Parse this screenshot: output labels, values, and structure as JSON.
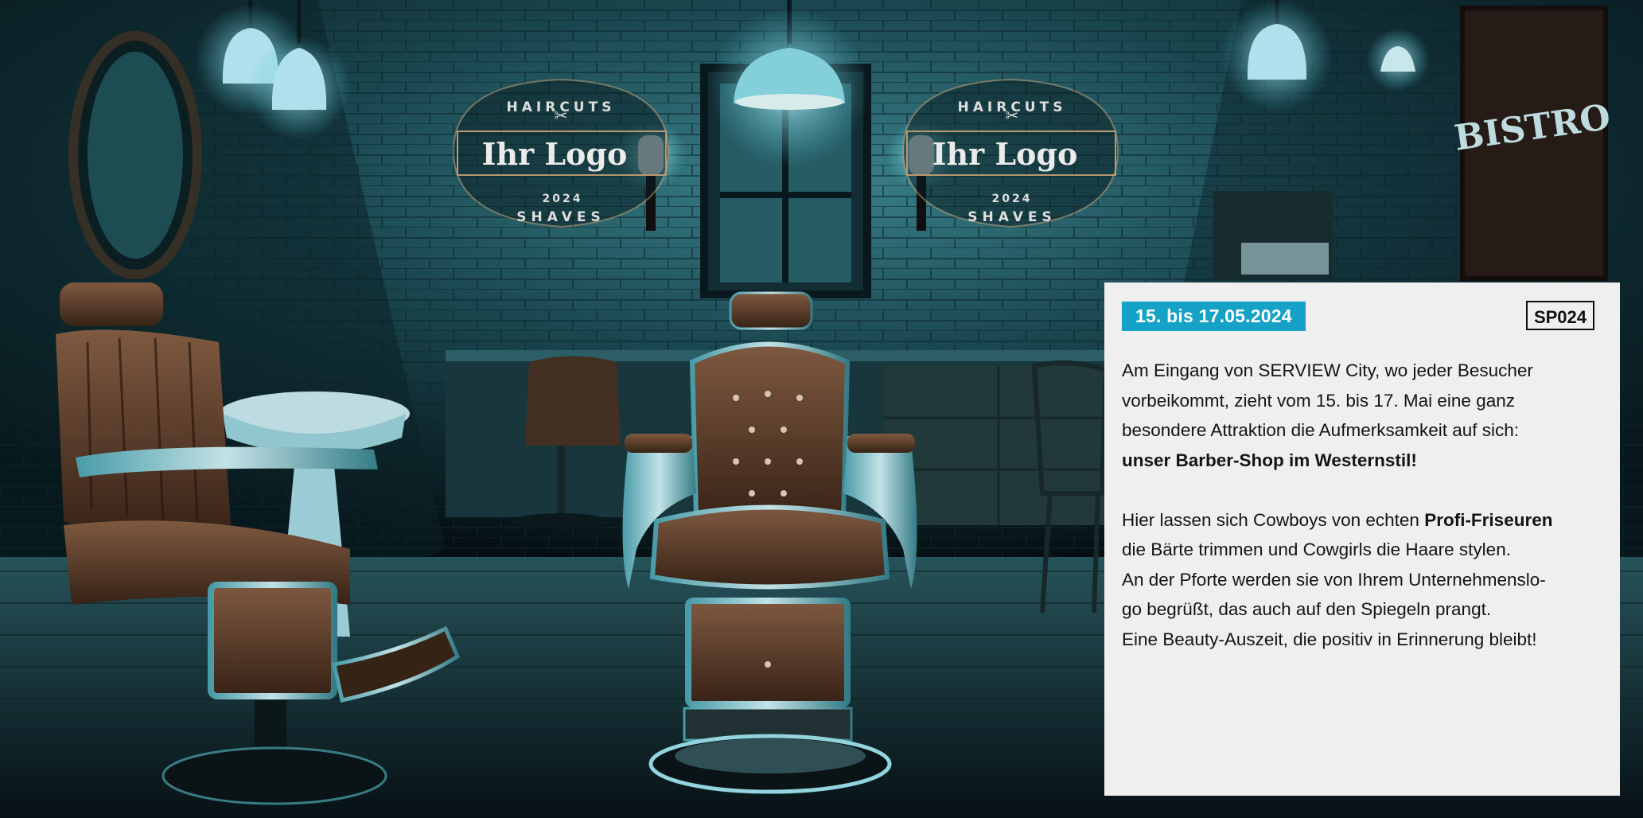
{
  "event": {
    "date_range": "15. bis 17.05.2024",
    "code": "SP024"
  },
  "description": {
    "p1_line1": "Am Eingang von SERVIEW City, wo jeder Besucher",
    "p1_line2": "vorbeikommt, zieht vom 15. bis 17. Mai eine ganz",
    "p1_line3": "besondere Attraktion die Aufmerksamkeit auf sich:",
    "p1_highlight": "unser Barber-Shop im Westernstil!",
    "p2_line1_pre": "Hier lassen sich Cowboys von echten ",
    "p2_line1_bold": "Profi-Friseuren",
    "p2_line2": "die Bärte trimmen und Cowgirls die Haare stylen.",
    "p2_line3": "An der Pforte werden sie von Ihrem Unternehmenslo-",
    "p2_line4": "go begrüßt, das auch auf den Spiegeln prangt.",
    "p2_line5": "Eine Beauty-Auszeit, die positiv in Erinnerung bleibt!"
  },
  "logo_signs": [
    {
      "top_arc": "HAIRCUTS",
      "name": "Ihr Logo",
      "year": "2024",
      "bottom_arc": "SHAVES"
    },
    {
      "top_arc": "HAIRCUTS",
      "name": "Ihr Logo",
      "year": "2024",
      "bottom_arc": "SHAVES"
    }
  ],
  "wall_sign": {
    "text": "BISTRO"
  },
  "colors": {
    "accent": "#15a2c6",
    "panel_background": "#efefef",
    "scene_tint": "#0f3a44",
    "lamp_glow": "#bff3ff",
    "leather": "#6b4a33"
  }
}
